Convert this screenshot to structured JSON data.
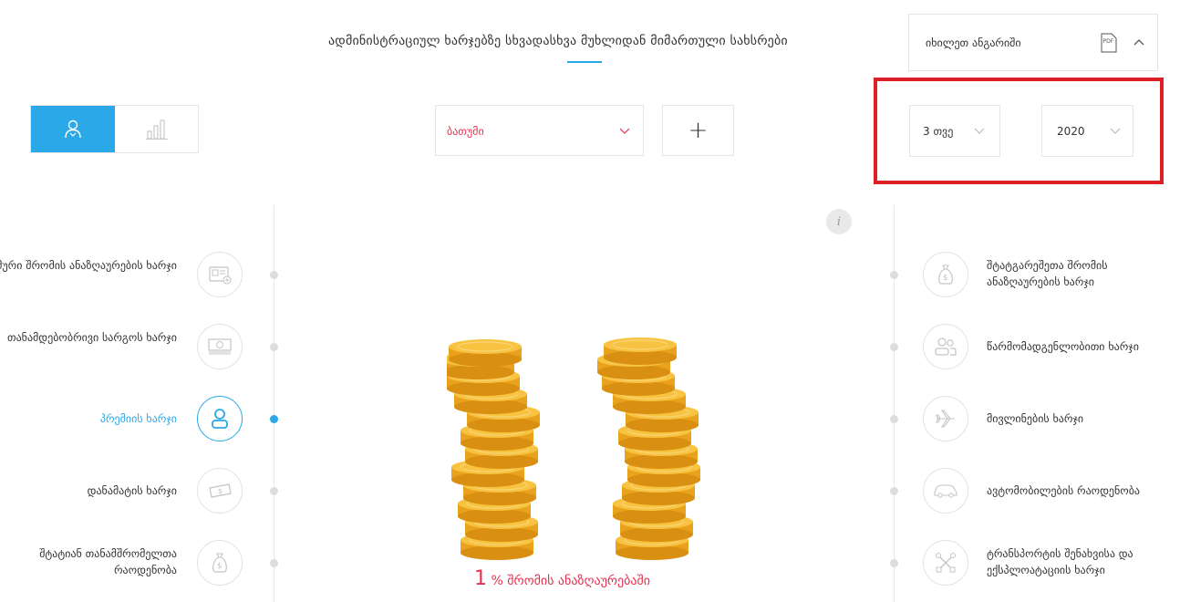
{
  "header": {
    "title": "ადმინისტრაციულ ხარჯებზე სხვადასხვა მუხლიდან მიმართული სახსრები",
    "report_label": "იხილეთ ანგარიში",
    "pdf_text": "PDF"
  },
  "filters": {
    "category_value": "ბათუმი",
    "month_value": "3 თვე",
    "year_value": "2020",
    "add_label": "+"
  },
  "info_label": "i",
  "left_items": [
    {
      "label": "ჯამური შრომის ანაზღაურების ხარჯი",
      "icon": "id-card-icon",
      "active": false
    },
    {
      "label": "თანამდებობრივი სარგოს ხარჯი",
      "icon": "banknote-icon",
      "active": false
    },
    {
      "label": "პრემიის ხარჯი",
      "icon": "user-icon",
      "active": true
    },
    {
      "label": "დანამატის ხარჯი",
      "icon": "money-icon",
      "active": false
    },
    {
      "label": "შტატიან თანამშრომელთა რაოდენობა",
      "icon": "money-bag-icon",
      "active": false
    }
  ],
  "right_items": [
    {
      "label": "შტატგარეშეთა შრომის ანაზღაურების ხარჯი",
      "icon": "money-bag-icon"
    },
    {
      "label": "წარმომადგენლობითი ხარჯი",
      "icon": "people-icon"
    },
    {
      "label": "მივლინების ხარჯი",
      "icon": "airplane-icon"
    },
    {
      "label": "ავტომობილების რაოდენობა",
      "icon": "car-icon"
    },
    {
      "label": "ტრანსპორტის შენახვისა და ექსპლოატაციის ხარჯი",
      "icon": "tools-icon"
    }
  ],
  "caption": {
    "number": "1",
    "text": "% შრომის ანაზღაურებაში"
  },
  "colors": {
    "accent": "#2aa8e8",
    "highlight_red": "#e8304e",
    "frame_red": "#dd1f26",
    "coin": "#f5b72a"
  }
}
